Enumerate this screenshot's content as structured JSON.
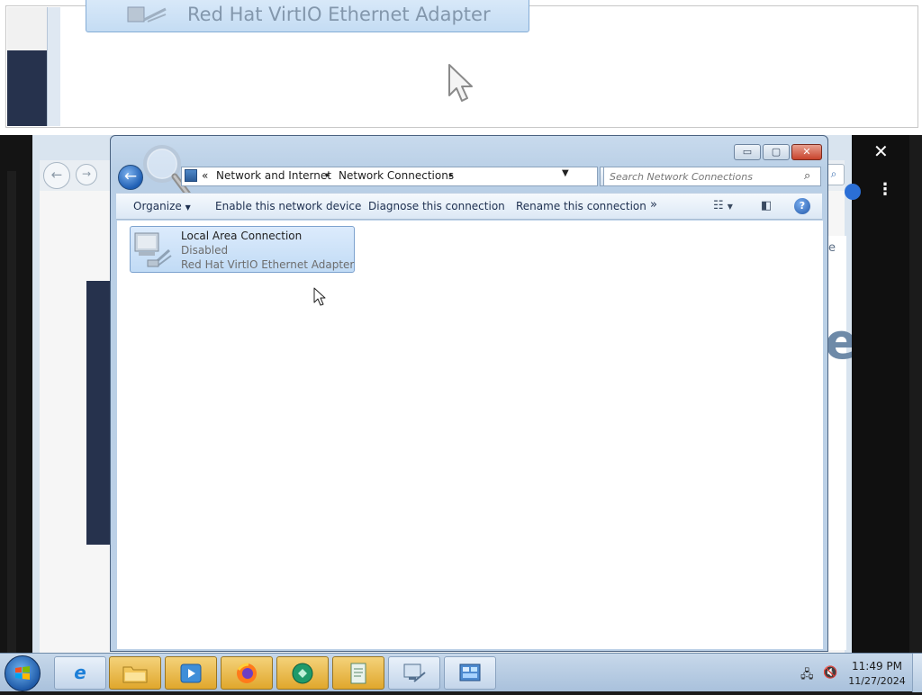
{
  "zoom_overlay": {
    "magnified_adapter_text": "Red Hat VirtIO Ethernet Adapter"
  },
  "background_window": {
    "right_edge_text": "e",
    "right_edge_large_text": "e"
  },
  "explorer": {
    "caption_buttons": {
      "minimize": "▭",
      "maximize": "▢",
      "close": "✕"
    },
    "address": {
      "breadcrumbs": [
        "Network and Internet",
        "Network Connections"
      ],
      "overflow": "«",
      "separator": "▸"
    },
    "search": {
      "placeholder": "Search Network Connections"
    },
    "command_bar": {
      "organize": "Organize",
      "enable": "Enable this network device",
      "diagnose": "Diagnose this connection",
      "rename": "Rename this connection",
      "more": "»"
    },
    "connections": [
      {
        "name": "Local Area Connection",
        "status": "Disabled",
        "adapter": "Red Hat VirtIO Ethernet Adapter",
        "icon": "network-adapter-icon"
      }
    ]
  },
  "taskbar": {
    "pinned": [
      {
        "name": "internet-explorer",
        "icon": "ie-icon",
        "active": false
      },
      {
        "name": "file-explorer",
        "icon": "folder-icon",
        "active": true
      },
      {
        "name": "media-player",
        "icon": "media-player-icon",
        "active": true
      },
      {
        "name": "firefox",
        "icon": "firefox-icon",
        "active": true
      },
      {
        "name": "app-green",
        "icon": "green-app-icon",
        "active": true
      },
      {
        "name": "notepad",
        "icon": "notepad-icon",
        "active": true
      },
      {
        "name": "network-connections",
        "icon": "network-window-icon",
        "active": false
      },
      {
        "name": "control-panel",
        "icon": "control-panel-icon",
        "active": false
      }
    ],
    "clock": {
      "time": "11:49 PM",
      "date": "11/27/2024"
    }
  },
  "colors": {
    "selection_tile": "#c9e0f7",
    "taskbar": "#b7cce3",
    "active_taskbar_item": "#e7b548"
  }
}
